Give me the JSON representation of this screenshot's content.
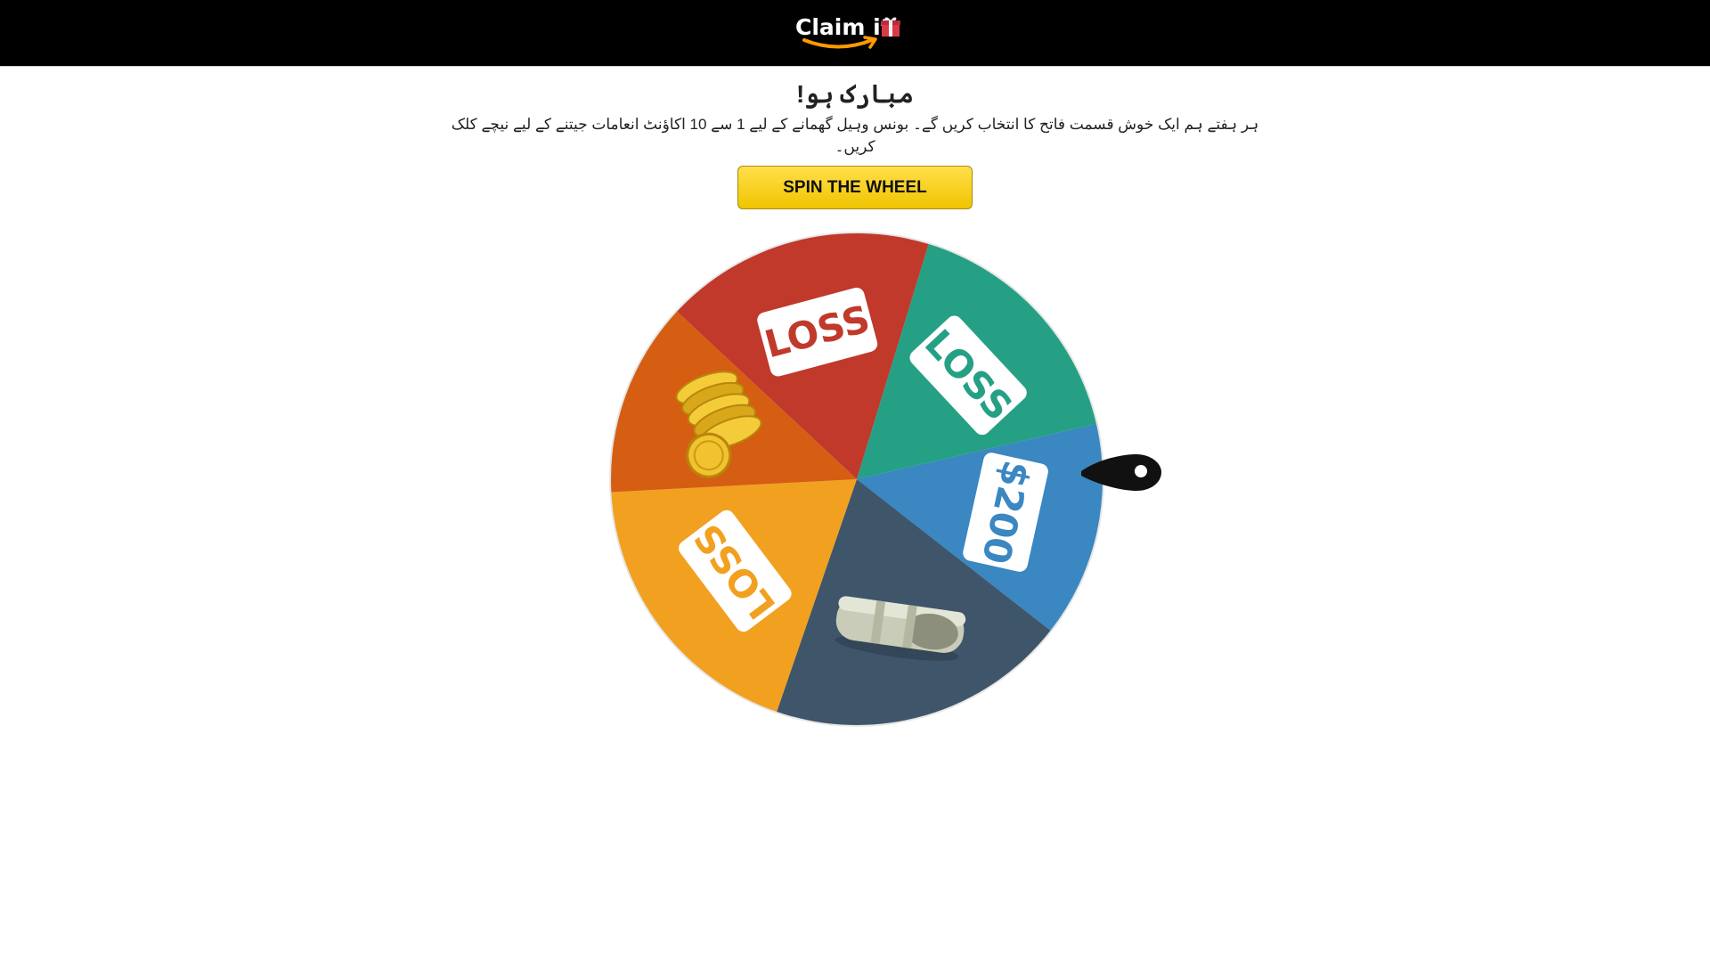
{
  "header": {
    "logo_text": "Claim it",
    "logo_icon": "gift-box-icon"
  },
  "promo": {
    "headline": "مبارک ہو!",
    "description": "ہر ہفتے ہم ایک خوش قسمت فاتح کا انتخاب کریں گے۔ بونس وہیل گھمانے کے لیے 1 سے 10 اکاؤنٹ انعامات جیتنے کے لیے نیچے کلک کریں۔"
  },
  "spin_button": {
    "label": "SPIN THE WHEEL"
  },
  "wheel": {
    "pointer_icon": "wheel-pointer-icon",
    "segments": [
      {
        "label": "LOSS",
        "color": "#c0392b",
        "kind": "text",
        "text_color": "#c0392b"
      },
      {
        "label": "LOSS",
        "color": "#26a085",
        "kind": "text",
        "text_color": "#26a085"
      },
      {
        "label": "$200",
        "color": "#3a87c2",
        "kind": "text",
        "text_color": "#3a87c2"
      },
      {
        "label": "",
        "color": "#3f5569",
        "kind": "image",
        "icon": "cash-bundle-icon"
      },
      {
        "label": "LOSS",
        "color": "#f2a01f",
        "kind": "text",
        "text_color": "#f2a01f"
      },
      {
        "label": "",
        "color": "#d55e13",
        "kind": "image",
        "icon": "gold-coins-icon"
      }
    ]
  },
  "colors": {
    "topbar": "#000000",
    "button": "#f5cc18",
    "accent_orange": "#ff9900"
  }
}
